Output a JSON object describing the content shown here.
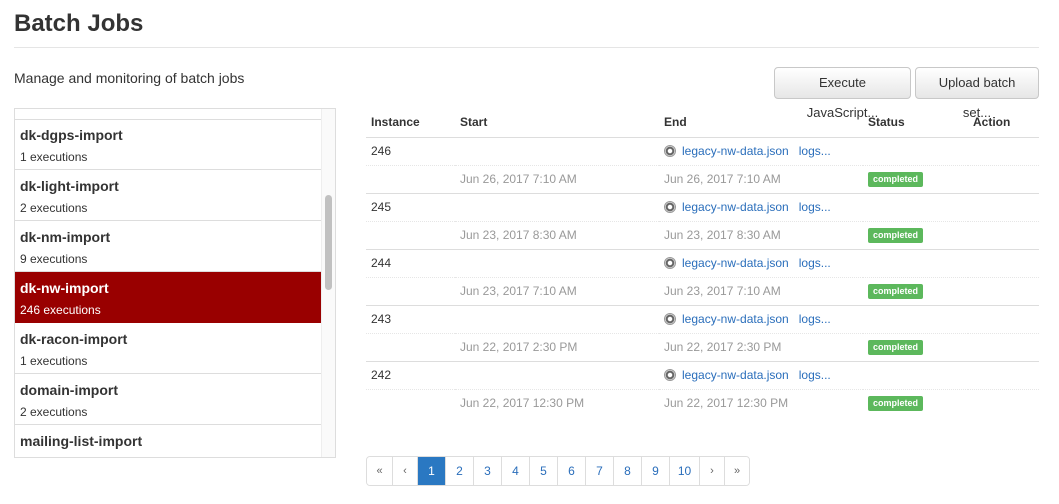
{
  "header": {
    "title": "Batch Jobs",
    "subtitle": "Manage and monitoring of batch jobs",
    "execute_label": "Execute JavaScript...",
    "upload_label": "Upload batch set..."
  },
  "sidebar": {
    "items": [
      {
        "name": "dk-dgps-import",
        "count": "1 executions"
      },
      {
        "name": "dk-light-import",
        "count": "2 executions"
      },
      {
        "name": "dk-nm-import",
        "count": "9 executions"
      },
      {
        "name": "dk-nw-import",
        "count": "246 executions",
        "active": true
      },
      {
        "name": "dk-racon-import",
        "count": "1 executions"
      },
      {
        "name": "domain-import",
        "count": "2 executions"
      },
      {
        "name": "mailing-list-import",
        "count": ""
      }
    ]
  },
  "table": {
    "headers": [
      "Instance",
      "Start",
      "End",
      "Status",
      "Action"
    ],
    "rows": [
      {
        "instance": "246",
        "file": "legacy-nw-data.json",
        "logs": "logs...",
        "start": "Jun 26, 2017 7:10 AM",
        "end": "Jun 26, 2017 7:10 AM",
        "status": "completed"
      },
      {
        "instance": "245",
        "file": "legacy-nw-data.json",
        "logs": "logs...",
        "start": "Jun 23, 2017 8:30 AM",
        "end": "Jun 23, 2017 8:30 AM",
        "status": "completed"
      },
      {
        "instance": "244",
        "file": "legacy-nw-data.json",
        "logs": "logs...",
        "start": "Jun 23, 2017 7:10 AM",
        "end": "Jun 23, 2017 7:10 AM",
        "status": "completed"
      },
      {
        "instance": "243",
        "file": "legacy-nw-data.json",
        "logs": "logs...",
        "start": "Jun 22, 2017 2:30 PM",
        "end": "Jun 22, 2017 2:30 PM",
        "status": "completed"
      },
      {
        "instance": "242",
        "file": "legacy-nw-data.json",
        "logs": "logs...",
        "start": "Jun 22, 2017 12:30 PM",
        "end": "Jun 22, 2017 12:30 PM",
        "status": "completed"
      }
    ]
  },
  "pagination": {
    "first": "«",
    "prev": "‹",
    "pages": [
      "1",
      "2",
      "3",
      "4",
      "5",
      "6",
      "7",
      "8",
      "9",
      "10"
    ],
    "current": "1",
    "next": "›",
    "last": "»"
  },
  "colors": {
    "active_job": "#990000",
    "status_completed": "#5cb85c",
    "link": "#2a6ebb",
    "active_page": "#2a78c2"
  },
  "icons": {
    "file": "file-icon"
  }
}
